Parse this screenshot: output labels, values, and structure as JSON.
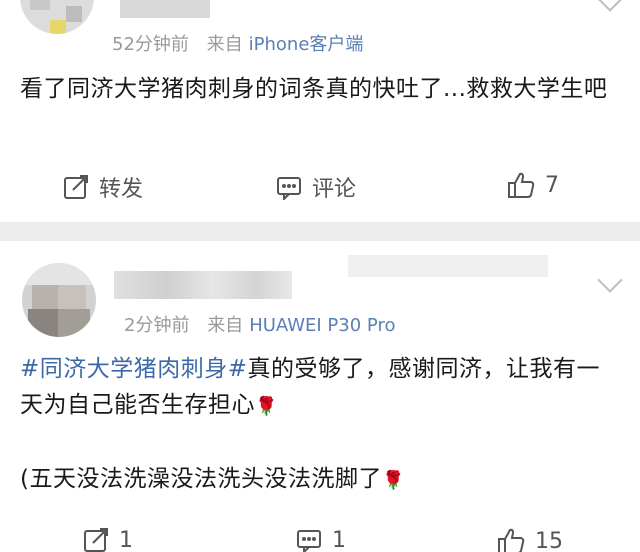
{
  "post1": {
    "time": "52分钟前",
    "source_prefix": "来自",
    "source": "iPhone客户端",
    "content": "看了同济大学猪肉刺身的词条真的快吐了...救救大学生吧",
    "actions": {
      "repost": "转发",
      "comment": "评论",
      "like_count": "7"
    }
  },
  "post2": {
    "time": "2分钟前",
    "source_prefix": "来自",
    "source": "HUAWEI P30 Pro",
    "topic": "#同济大学猪肉刺身#",
    "content_line1": "真的受够了，感谢同济，让我有一天为自己能否生存担心",
    "flower": "🌹",
    "content_line2": "(五天没法洗澡没法洗头没法洗脚了",
    "actions": {
      "repost_count": "1",
      "comment_count": "1",
      "like_count": "15"
    }
  },
  "colors": {
    "link": "#3c6aa8",
    "meta": "#9a9a9a",
    "separator": "#ededed"
  },
  "icons": {
    "repost": "share-edit-icon",
    "comment": "comment-icon",
    "like": "thumbs-up-icon",
    "menu": "chevron-down-icon",
    "emoji": "rose"
  }
}
